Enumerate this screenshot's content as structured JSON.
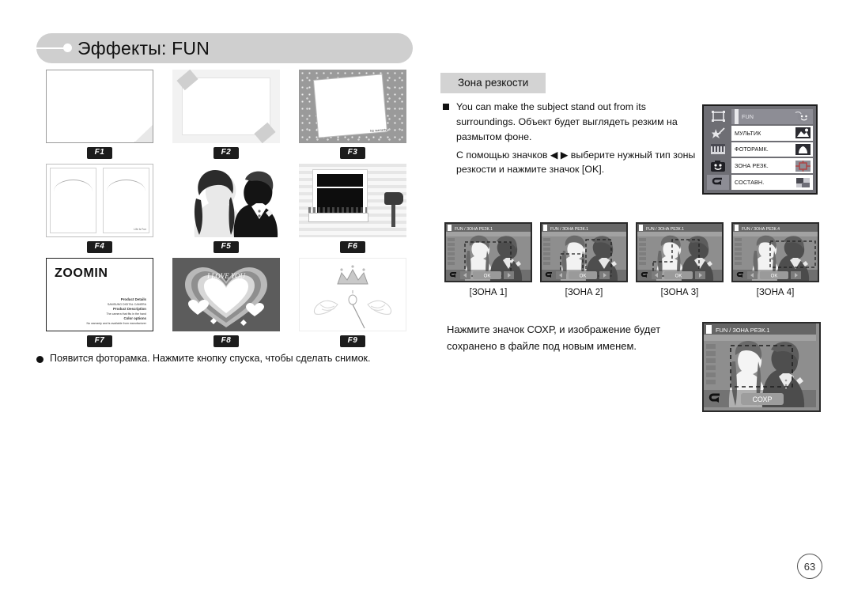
{
  "header": {
    "title": "Эффекты: FUN"
  },
  "gallery": {
    "frames": [
      {
        "id": "f1",
        "label": "F1",
        "prefix": "F",
        "num": "1"
      },
      {
        "id": "f2",
        "label": "F2",
        "prefix": "F",
        "num": "2"
      },
      {
        "id": "f3",
        "label": "F3",
        "prefix": "F",
        "num": "3",
        "caption": "No warranty"
      },
      {
        "id": "f4",
        "label": "F4",
        "prefix": "F",
        "num": "4",
        "caption": "Life Is Fun"
      },
      {
        "id": "f5",
        "label": "F5",
        "prefix": "F",
        "num": "5"
      },
      {
        "id": "f6",
        "label": "F6",
        "prefix": "F",
        "num": "6"
      },
      {
        "id": "f7",
        "label": "F7",
        "prefix": "F",
        "num": "7",
        "title": "ZOOMIN",
        "details": [
          "Product Details",
          "SAMSUNG DIGITAL CAMERA",
          "Product Description",
          "The camera that fits in the hand",
          "Color options",
          "No warranty and is available from manufacturer"
        ]
      },
      {
        "id": "f8",
        "label": "F8",
        "prefix": "F",
        "num": "8",
        "title": "I LOVE YOU"
      },
      {
        "id": "f9",
        "label": "F9",
        "prefix": "F",
        "num": "9"
      }
    ],
    "note": "Появится фоторамка. Нажмите кнопку спуска, чтобы сделать снимок."
  },
  "section": {
    "label": "Зона резкости",
    "paragraphs": [
      "You can make the subject stand out from its surroundings. Объект будет выглядеть резким на размытом фоне.",
      "С помощью значков ◀ ▶ выберите нужный тип зоны резкости и нажмите значок [OK]."
    ]
  },
  "menu_lcd": {
    "icons": [
      {
        "name": "frame-icon",
        "active": false
      },
      {
        "name": "star-wand-icon",
        "active": false
      },
      {
        "name": "film-curtain-icon",
        "active": false
      },
      {
        "name": "smiley-camera-icon",
        "active": false
      },
      {
        "name": "back-arrow-icon",
        "active": true
      }
    ],
    "rows": [
      {
        "label": "FUN",
        "icon": "smiley-face-icon",
        "selected": true
      },
      {
        "label": "МУЛЬТИК",
        "icon": "cartoon-photo-icon",
        "selected": false
      },
      {
        "label": "ФОТОРАМК.",
        "icon": "photo-frame-icon",
        "selected": false
      },
      {
        "label": "ЗОНА РЕЗК.",
        "icon": "focus-brackets-icon",
        "selected": false
      },
      {
        "label": "СОСТАВН.",
        "icon": "composite-squares-icon",
        "selected": false
      }
    ]
  },
  "lcd_thumbs": [
    {
      "header": "FUN / ЗОНА РЕЗК.1",
      "caption": "[ЗОНА 1]",
      "ok": "OK",
      "zone": 1
    },
    {
      "header": "FUN / ЗОНА РЕЗК.1",
      "caption": "[ЗОНА 2]",
      "ok": "OK",
      "zone": 2
    },
    {
      "header": "FUN / ЗОНА РЕЗК.1",
      "caption": "[ЗОНА 3]",
      "ok": "OK",
      "zone": 3
    },
    {
      "header": "FUN / ЗОНА РЕЗК.4",
      "caption": "[ЗОНА 4]",
      "ok": "OK",
      "zone": 4
    }
  ],
  "save": {
    "text_line1": "Нажмите значок СОХР, и изображение будет",
    "text_line2": "сохранено в файле под новым именем.",
    "lcd_header": "FUN / ЗОНА РЕЗК.1",
    "button": "СОХР"
  },
  "page_number": "63",
  "colors": {
    "header_bar": "#cfcfcf",
    "section_label": "#d3d3d3",
    "lcd_body": "#6e6e74",
    "focus_red": "#b04040"
  }
}
